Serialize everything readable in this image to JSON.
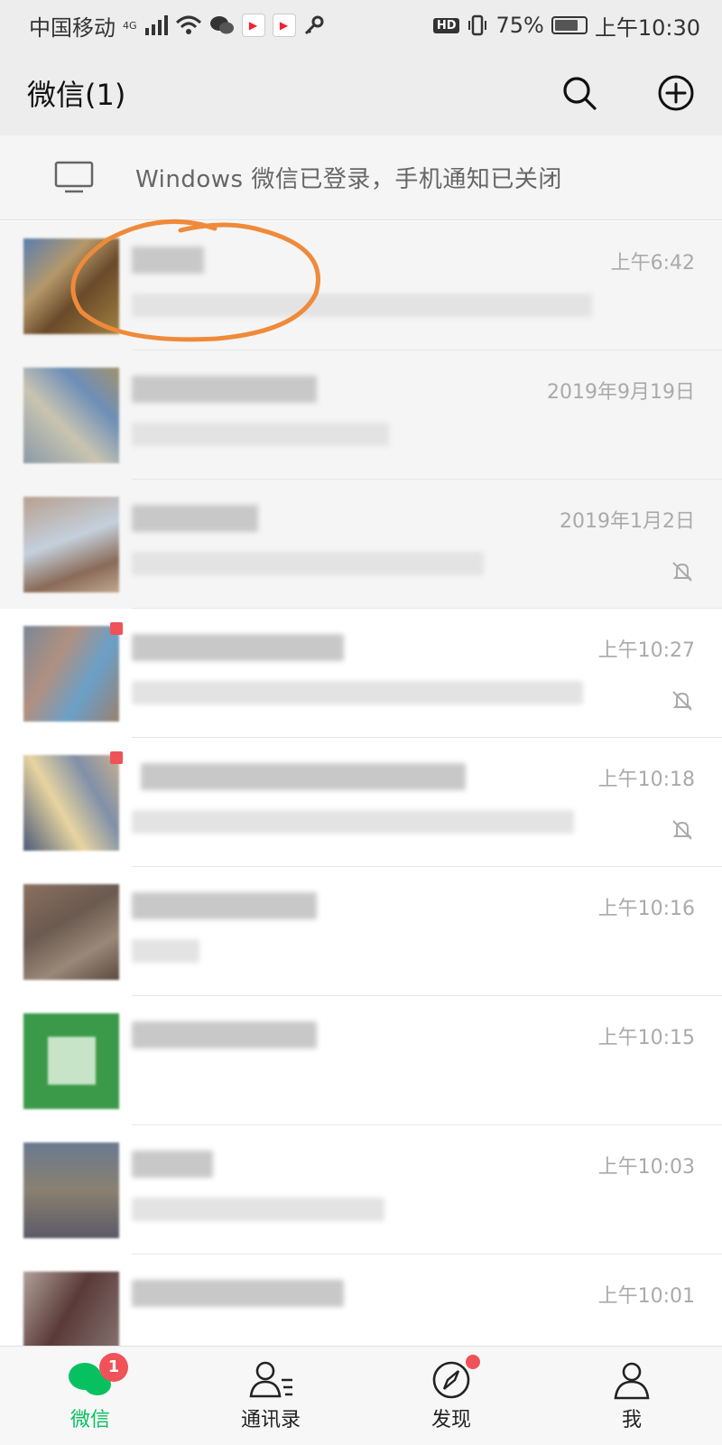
{
  "status_bar": {
    "carrier": "中国移动",
    "network": "4G",
    "hd": "HD",
    "battery": "75%",
    "time": "上午10:30"
  },
  "header": {
    "title": "微信(1)",
    "icons": [
      "search-icon",
      "add-circle-icon"
    ]
  },
  "banner": {
    "text": "Windows 微信已登录，手机通知已关闭"
  },
  "chats": [
    {
      "time": "上午6:42",
      "muted": false,
      "pinned": true,
      "unread_dot": false
    },
    {
      "time": "2019年9月19日",
      "muted": false,
      "pinned": true,
      "unread_dot": false
    },
    {
      "time": "2019年1月2日",
      "muted": true,
      "pinned": true,
      "unread_dot": false
    },
    {
      "time": "上午10:27",
      "muted": true,
      "pinned": false,
      "unread_dot": true
    },
    {
      "time": "上午10:18",
      "muted": true,
      "pinned": false,
      "unread_dot": true
    },
    {
      "time": "上午10:16",
      "muted": false,
      "pinned": false,
      "unread_dot": false
    },
    {
      "time": "上午10:15",
      "muted": false,
      "pinned": false,
      "unread_dot": false
    },
    {
      "time": "上午10:03",
      "muted": false,
      "pinned": false,
      "unread_dot": false
    },
    {
      "time": "上午10:01",
      "muted": false,
      "pinned": false,
      "unread_dot": false
    }
  ],
  "tabs": [
    {
      "label": "微信",
      "badge": "1",
      "active": true
    },
    {
      "label": "通讯录",
      "active": false
    },
    {
      "label": "发现",
      "dot": true,
      "active": false
    },
    {
      "label": "我",
      "active": false
    }
  ],
  "colors": {
    "accent": "#07c160",
    "badge": "#f0525a",
    "annotation": "#ef8a3a"
  }
}
